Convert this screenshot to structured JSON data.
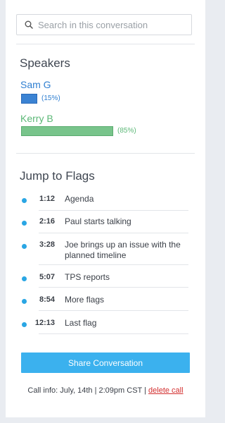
{
  "search": {
    "placeholder": "Search in this conversation"
  },
  "speakers": {
    "title": "Speakers",
    "items": [
      {
        "name": "Sam G",
        "percent_label": "(15%)",
        "share": 0.15,
        "color": "#3b83d3"
      },
      {
        "name": "Kerry B",
        "percent_label": "(85%)",
        "share": 0.85,
        "color": "#78c48b"
      }
    ]
  },
  "flags": {
    "title": "Jump to Flags",
    "items": [
      {
        "time": "1:12",
        "label": "Agenda"
      },
      {
        "time": "2:16",
        "label": "Paul starts talking"
      },
      {
        "time": "3:28",
        "label": "Joe brings up an issue with the planned timeline"
      },
      {
        "time": "5:07",
        "label": "TPS reports"
      },
      {
        "time": "8:54",
        "label": "More flags"
      },
      {
        "time": "12:13",
        "label": "Last flag"
      }
    ],
    "dot_color": "#2aa6e4"
  },
  "share_button": {
    "label": "Share Conversation",
    "color": "#3bb1ee"
  },
  "call_info": {
    "prefix": "Call info: July, 14th | 2:09pm CST | ",
    "delete_label": "delete call"
  }
}
